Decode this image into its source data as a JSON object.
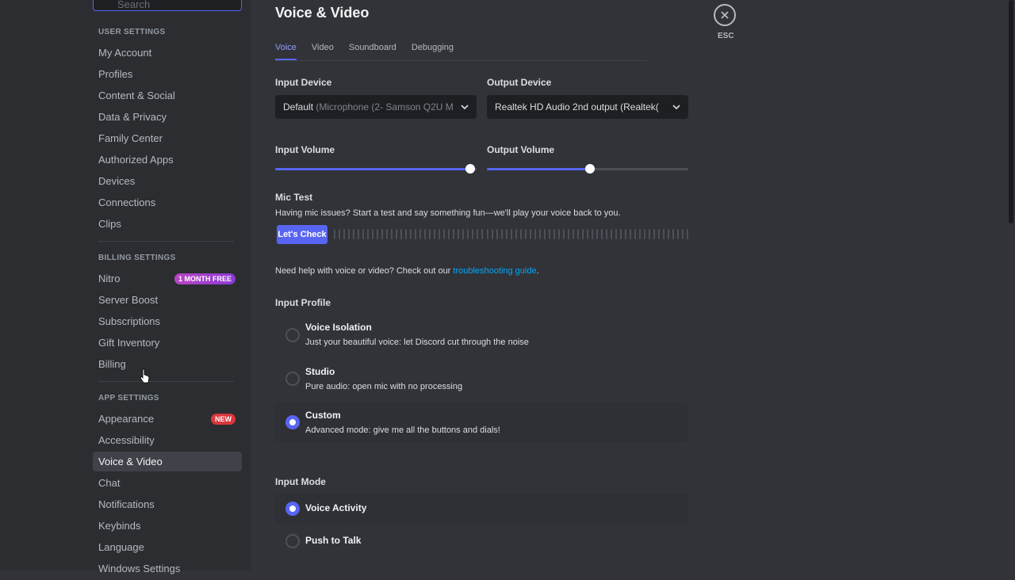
{
  "sidebar": {
    "search_placeholder": "Search",
    "sections": {
      "user": "User Settings",
      "billing": "Billing Settings",
      "app": "App Settings"
    },
    "user_items": [
      "My Account",
      "Profiles",
      "Content & Social",
      "Data & Privacy",
      "Family Center",
      "Authorized Apps",
      "Devices",
      "Connections",
      "Clips"
    ],
    "billing_items": [
      "Nitro",
      "Server Boost",
      "Subscriptions",
      "Gift Inventory",
      "Billing"
    ],
    "app_items": [
      "Appearance",
      "Accessibility",
      "Voice & Video",
      "Chat",
      "Notifications",
      "Keybinds",
      "Language",
      "Windows Settings"
    ],
    "nitro_badge": "1 MONTH FREE",
    "new_badge": "NEW",
    "active_item": "Voice & Video"
  },
  "main": {
    "title": "Voice & Video",
    "tabs": [
      "Voice",
      "Video",
      "Soundboard",
      "Debugging"
    ],
    "active_tab": "Voice",
    "input_device": {
      "label": "Input Device",
      "value_main": "Default",
      "value_dim": "(Microphone (2- Samson Q2U M"
    },
    "output_device": {
      "label": "Output Device",
      "value": "Realtek HD Audio 2nd output (Realtek("
    },
    "input_volume": {
      "label": "Input Volume",
      "value_percent": 97
    },
    "output_volume": {
      "label": "Output Volume",
      "value_percent": 51
    },
    "mic_test": {
      "label": "Mic Test",
      "desc": "Having mic issues? Start a test and say something fun—we'll play your voice back to you.",
      "button": "Let's Check"
    },
    "help": {
      "text_before": "Need help with voice or video? Check out our ",
      "link": "troubleshooting guide",
      "text_after": "."
    },
    "input_profile": {
      "label": "Input Profile",
      "options": [
        {
          "title": "Voice Isolation",
          "desc": "Just your beautiful voice: let Discord cut through the noise",
          "selected": false
        },
        {
          "title": "Studio",
          "desc": "Pure audio: open mic with no processing",
          "selected": false
        },
        {
          "title": "Custom",
          "desc": "Advanced mode: give me all the buttons and dials!",
          "selected": true
        }
      ]
    },
    "input_mode": {
      "label": "Input Mode",
      "options": [
        {
          "title": "Voice Activity",
          "selected": true
        },
        {
          "title": "Push to Talk",
          "selected": false
        }
      ]
    },
    "esc_label": "ESC"
  },
  "colors": {
    "accent": "#5865f2",
    "link": "#00a8fc",
    "background": "#313338",
    "sidebar": "#2b2d31"
  },
  "icons": {
    "close": "close-icon",
    "chevron": "chevron-down-icon",
    "search": "search-icon",
    "cursor": "mouse-pointer-icon"
  }
}
